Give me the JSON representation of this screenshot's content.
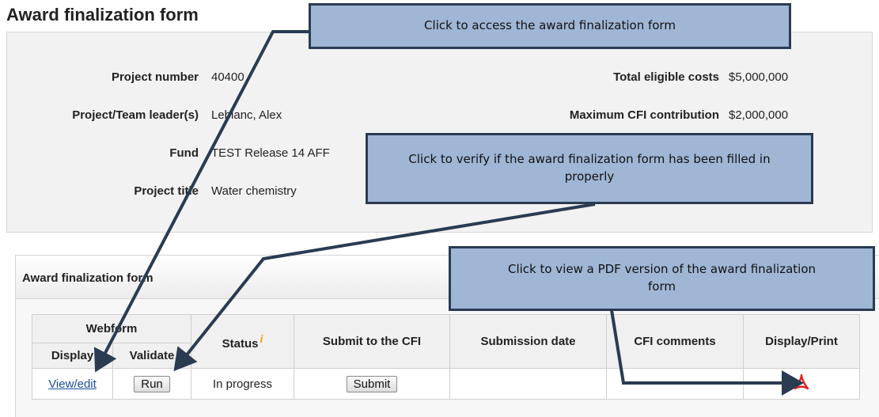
{
  "page_title": "Award finalization form",
  "summary": {
    "project_number_label": "Project number",
    "project_number": "40400",
    "leader_label": "Project/Team leader(s)",
    "leader": "Leblanc, Alex",
    "fund_label": "Fund",
    "fund": "TEST Release 14 AFF",
    "title_label": "Project title",
    "title": "Water chemistry",
    "total_costs_label": "Total eligible costs",
    "total_costs": "$5,000,000",
    "max_contribution_label": "Maximum CFI contribution",
    "max_contribution": "$2,000,000"
  },
  "section_title": "Award finalization form",
  "table": {
    "webform_header": "Webform",
    "display_header": "Display",
    "validate_header": "Validate",
    "status_header": "Status",
    "submit_header": "Submit to the CFI",
    "submission_date_header": "Submission date",
    "comments_header": "CFI comments",
    "print_header": "Display/Print",
    "row": {
      "view_link": "View/edit",
      "run_button": "Run",
      "status": "In progress",
      "submit_button": "Submit",
      "submission_date": "",
      "comments": ""
    }
  },
  "callouts": {
    "access": "Click to access the award finalization form",
    "verify": "Click to verify if the award finalization form has been filled in properly",
    "pdf": "Click to view a PDF version of the award finalization form"
  },
  "icons": {
    "info": "info-icon",
    "pdf": "pdf-icon"
  },
  "colors": {
    "callout_fill": "#9fb6d5",
    "callout_border": "#2a3b52",
    "link": "#1a4fa0",
    "pdf_red": "#e02020"
  }
}
